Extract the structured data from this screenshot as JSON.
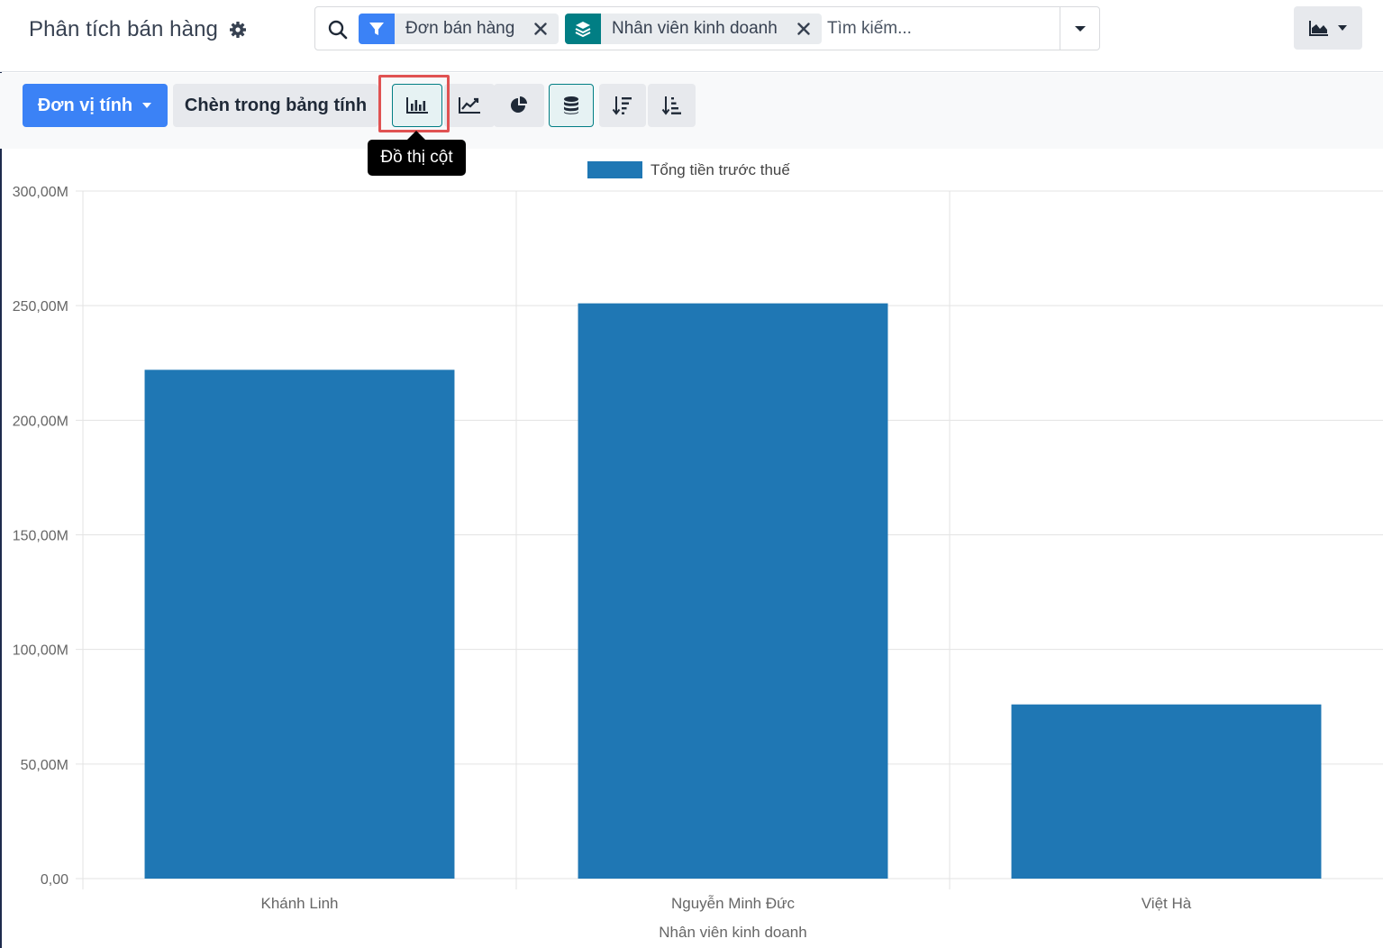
{
  "header": {
    "title": "Phân tích bán hàng"
  },
  "search": {
    "facets": [
      {
        "label": "Đơn bán hàng",
        "icon": "filter-icon",
        "color": "#3b82f6"
      },
      {
        "label": "Nhân viên kinh doanh",
        "icon": "layers-icon",
        "color": "#017e84"
      }
    ],
    "placeholder": "Tìm kiếm..."
  },
  "toolbar": {
    "measure_label": "Đơn vị tính",
    "insert_label": "Chèn trong bảng tính",
    "active_chart": "bar",
    "tooltip": "Đồ thị cột"
  },
  "colors": {
    "primary": "#3b82f6",
    "accent": "#017e84",
    "bar": "#1f77b4",
    "highlight": "#e05252"
  },
  "chart_data": {
    "type": "bar",
    "categories": [
      "Khánh Linh",
      "Nguyễn Minh Đức",
      "Việt Hà"
    ],
    "series": [
      {
        "name": "Tổng tiền trước thuế",
        "values": [
          222000000,
          251000000,
          76000000
        ],
        "color": "#1f77b4"
      }
    ],
    "xlabel": "Nhân viên kinh doanh",
    "ylabel": "",
    "ylim": [
      0,
      300000000
    ],
    "yticks": [
      0,
      50000000,
      100000000,
      150000000,
      200000000,
      250000000,
      300000000
    ],
    "ytick_labels": [
      "0,00",
      "50,00M",
      "100,00M",
      "150,00M",
      "200,00M",
      "250,00M",
      "300,00M"
    ],
    "grid": true,
    "legend_position": "top-center"
  }
}
